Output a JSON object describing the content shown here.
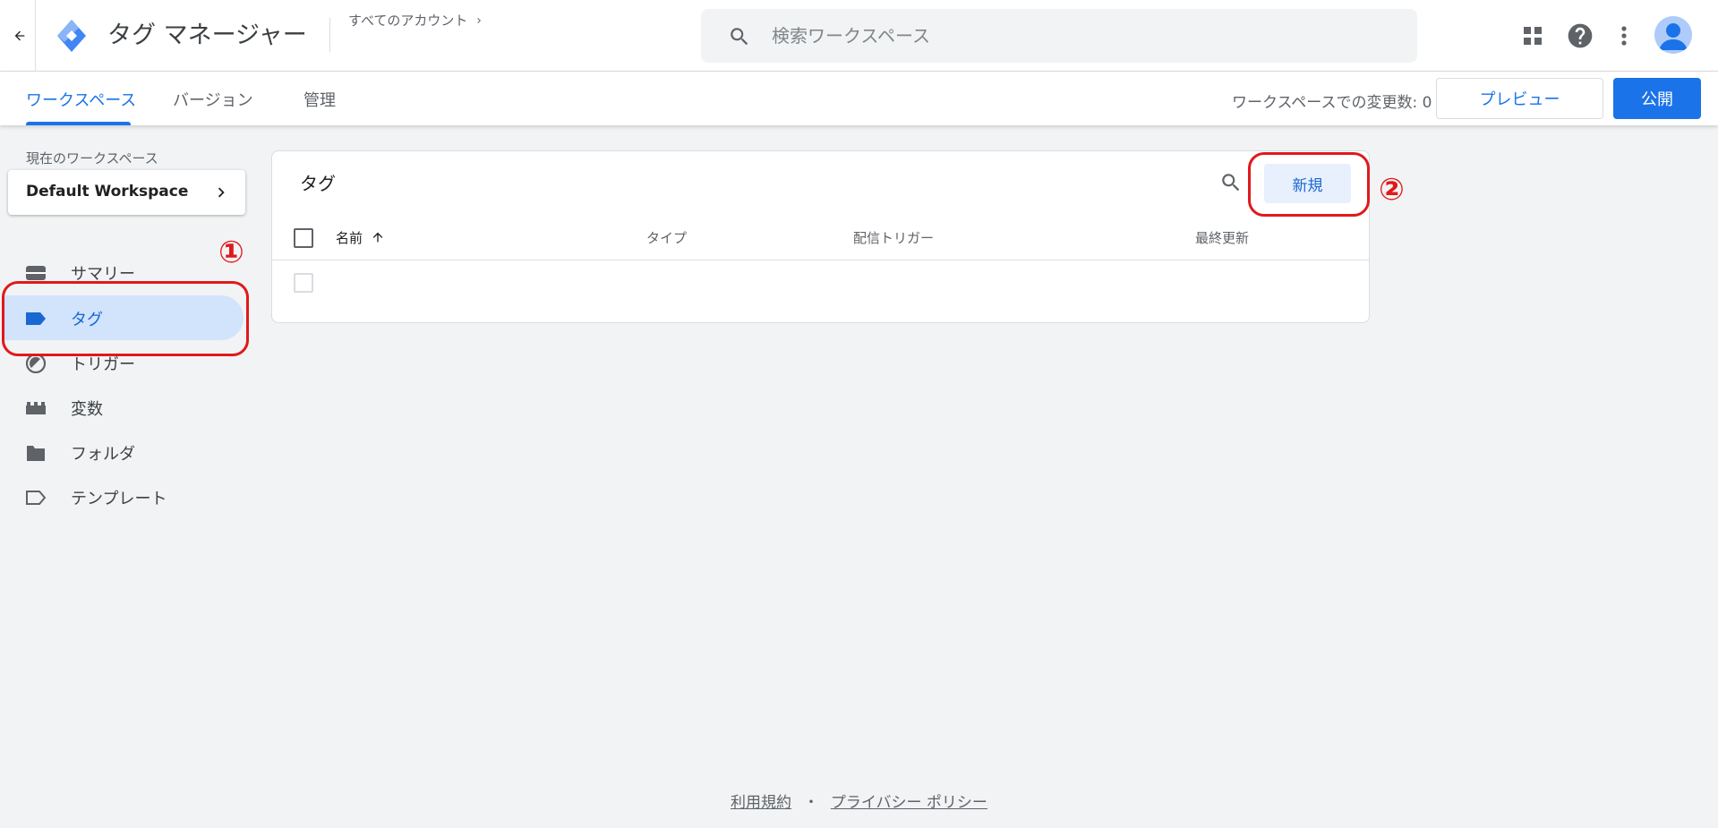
{
  "header": {
    "back_icon": "arrow-back-icon",
    "title": "タグ マネージャー",
    "breadcrumb": "すべてのアカウント",
    "search_placeholder": "検索ワークスペース",
    "icons": [
      "apps-grid-icon",
      "help-icon",
      "more-vert-icon",
      "account-avatar-icon"
    ]
  },
  "nav": {
    "tabs": [
      {
        "label": "ワークスペース",
        "active": true
      },
      {
        "label": "バージョン",
        "active": false
      },
      {
        "label": "管理",
        "active": false
      }
    ],
    "changes_label": "ワークスペースでの変更数: 0",
    "preview_label": "プレビュー",
    "publish_label": "公開"
  },
  "sidebar": {
    "workspace_label": "現在のワークスペース",
    "workspace_name": "Default Workspace",
    "items": [
      {
        "label": "サマリー",
        "icon": "summary-icon",
        "active": false
      },
      {
        "label": "タグ",
        "icon": "tag-icon",
        "active": true
      },
      {
        "label": "トリガー",
        "icon": "trigger-icon",
        "active": false
      },
      {
        "label": "変数",
        "icon": "variable-icon",
        "active": false
      },
      {
        "label": "フォルダ",
        "icon": "folder-icon",
        "active": false
      },
      {
        "label": "テンプレート",
        "icon": "template-icon",
        "active": false
      }
    ]
  },
  "card": {
    "title": "タグ",
    "new_label": "新規",
    "columns": {
      "name": "名前",
      "type": "タイプ",
      "trigger": "配信トリガー",
      "updated": "最終更新"
    }
  },
  "annotations": {
    "one": "①",
    "two": "②"
  },
  "footer": {
    "terms": "利用規約",
    "separator": "・",
    "privacy": "プライバシー ポリシー"
  },
  "colors": {
    "accent": "#1a73e8",
    "active_bg": "#d2e3fc",
    "annotation": "#e0191b"
  }
}
